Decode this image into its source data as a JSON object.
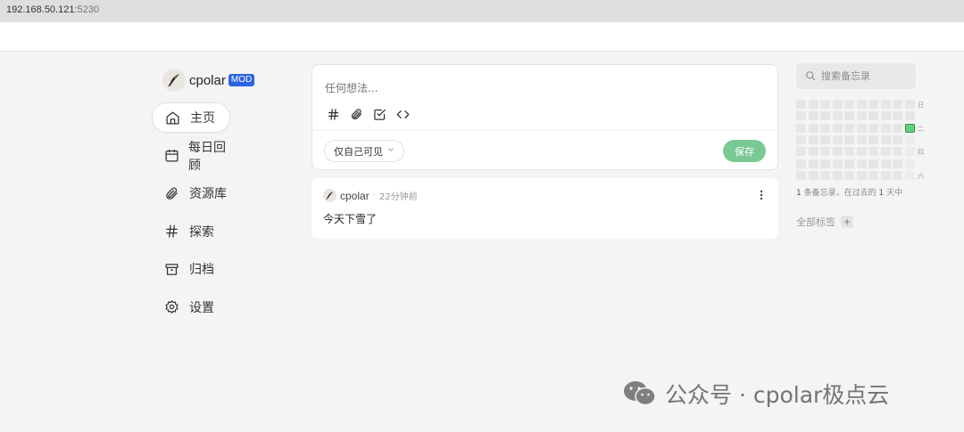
{
  "browser": {
    "address_host": "192.168.50.121",
    "address_port": ":5230"
  },
  "brand": {
    "name": "cpolar",
    "badge": "MOD"
  },
  "nav": [
    {
      "label": "主页",
      "icon": "home-icon",
      "active": true
    },
    {
      "label": "每日回顾",
      "icon": "calendar-icon",
      "active": false
    },
    {
      "label": "资源库",
      "icon": "paperclip-icon",
      "active": false
    },
    {
      "label": "探索",
      "icon": "hash-icon",
      "active": false
    },
    {
      "label": "归档",
      "icon": "archive-icon",
      "active": false
    },
    {
      "label": "设置",
      "icon": "gear-icon",
      "active": false
    }
  ],
  "editor": {
    "placeholder": "任何想法...",
    "tools": [
      "hash-icon",
      "paperclip-icon",
      "checkbox-icon",
      "code-icon"
    ],
    "visibility": "仅自己可见",
    "save_label": "保存"
  },
  "memo": {
    "user": "cpolar",
    "separator": "·",
    "time": "22分钟前",
    "content": "今天下雪了"
  },
  "sidebar_right": {
    "search_placeholder": "搜索备忘录",
    "weekdays": [
      "日",
      "二",
      "四",
      "六"
    ],
    "stats": {
      "prefix": "1",
      "mid": " 条备忘录，在过去的 ",
      "days": "1",
      "suffix": " 天中"
    },
    "tags_label": "全部标签",
    "heatmap": {
      "columns": 10,
      "rows": 7,
      "active_cells": [
        {
          "col": 9,
          "row": 2
        }
      ],
      "future_cells_from": {
        "col": 9,
        "row": 3
      }
    }
  },
  "watermark": {
    "text": "公众号 · cpolar极点云",
    "icon": "wechat-icon"
  },
  "colors": {
    "accent_green": "#7ac995",
    "badge_blue": "#2c63e6",
    "heat_active": "#5fd27b"
  }
}
